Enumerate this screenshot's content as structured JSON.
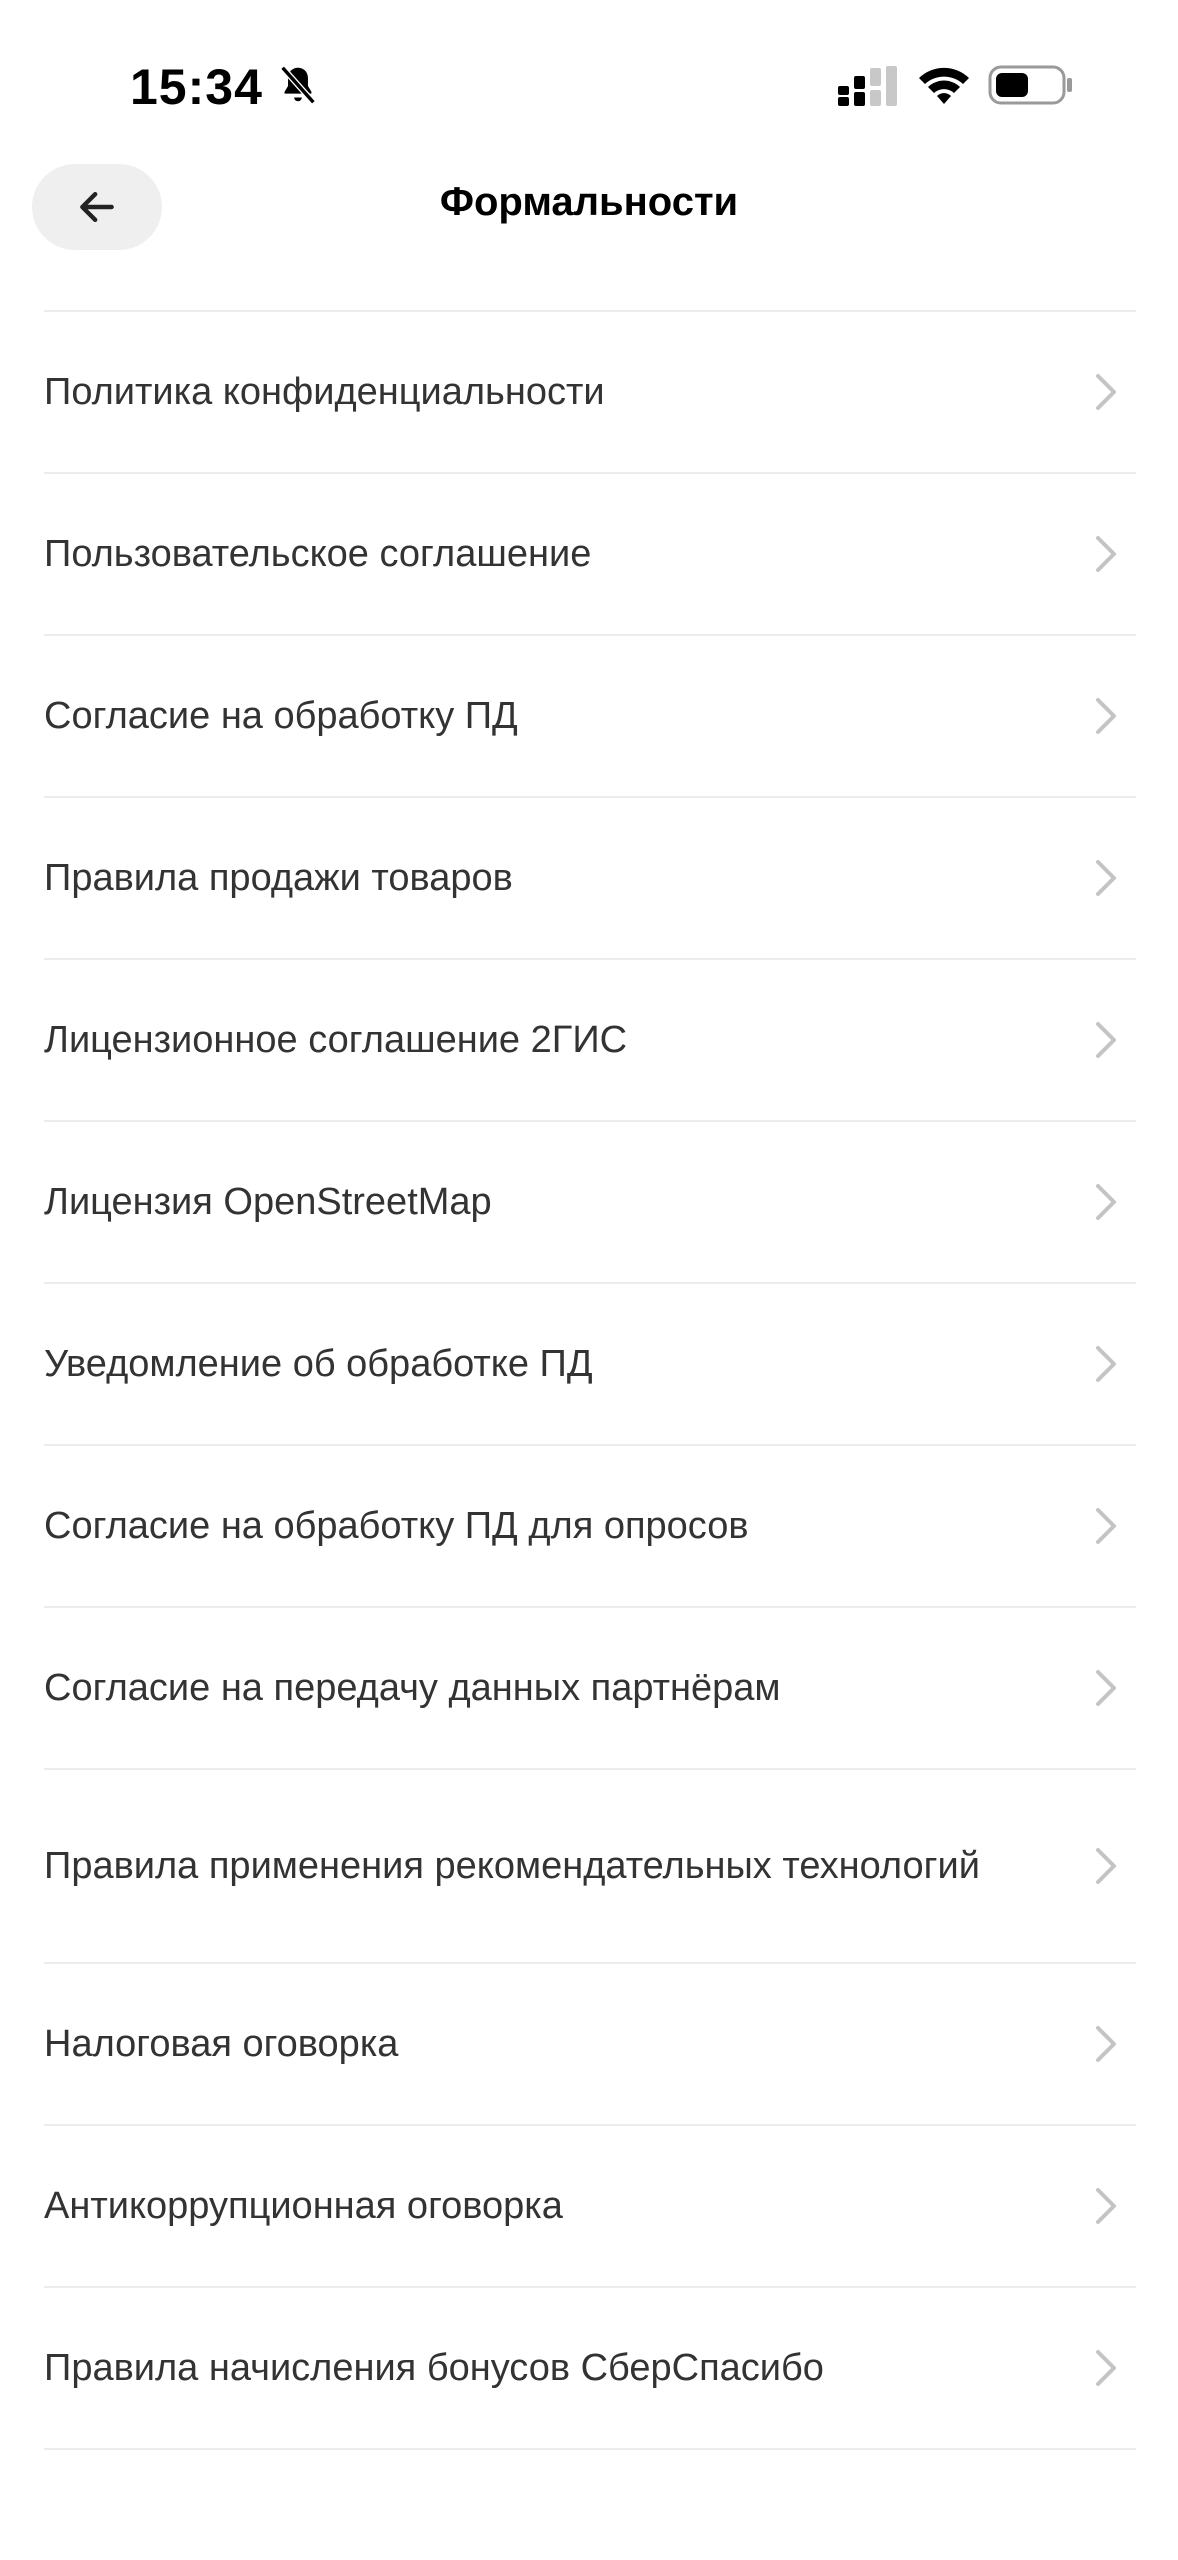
{
  "status_bar": {
    "time": "15:34",
    "icons": [
      "bell-muted-icon",
      "cellular-signal-icon",
      "wifi-icon",
      "battery-icon"
    ]
  },
  "header": {
    "title": "Формальности",
    "back_icon": "arrow-left-icon"
  },
  "items": [
    {
      "label": "Политика конфиденциальности"
    },
    {
      "label": "Пользовательское соглашение"
    },
    {
      "label": "Согласие на обработку ПД"
    },
    {
      "label": "Правила продажи товаров"
    },
    {
      "label": "Лицензионное соглашение 2ГИС"
    },
    {
      "label": "Лицензия OpenStreetMap"
    },
    {
      "label": "Уведомление об обработке ПД"
    },
    {
      "label": "Согласие на обработку ПД для опросов"
    },
    {
      "label": "Согласие на передачу данных партнёрам"
    },
    {
      "label": "Правила применения рекомендательных технологий"
    },
    {
      "label": "Налоговая оговорка"
    },
    {
      "label": "Антикоррупционная оговорка"
    },
    {
      "label": "Правила начисления бонусов СберСпасибо"
    }
  ],
  "colors": {
    "text": "#333333",
    "divider": "#ececec",
    "chevron": "#c4c4c4",
    "back_button_bg": "#efefef"
  }
}
